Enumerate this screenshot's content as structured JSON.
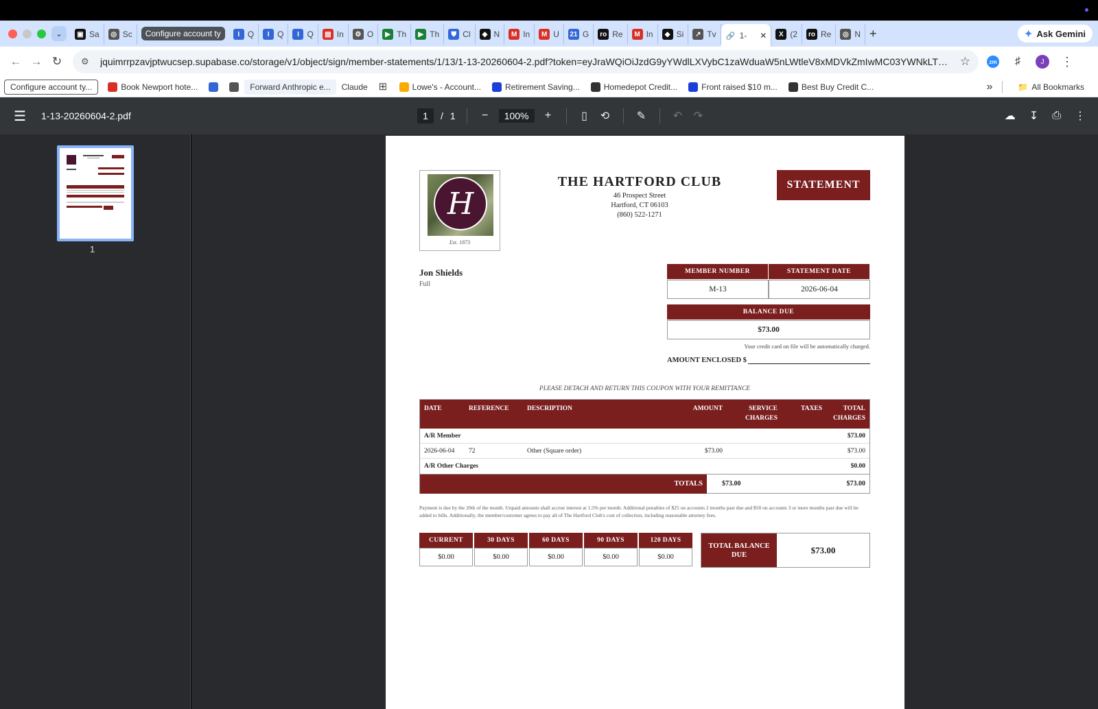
{
  "browser": {
    "tab_group_label": "Configure account ty",
    "tabs": [
      {
        "label": "Sa",
        "icon": "square-icon",
        "color": "#111111"
      },
      {
        "label": "Sc",
        "icon": "globe-icon",
        "color": "#555555"
      },
      {
        "label": "Q",
        "icon": "i-icon",
        "color": "#3367d6"
      },
      {
        "label": "Q",
        "icon": "i-icon",
        "color": "#3367d6"
      },
      {
        "label": "Q",
        "icon": "i-icon",
        "color": "#3367d6"
      },
      {
        "label": "In",
        "icon": "doc-icon",
        "color": "#d93025"
      },
      {
        "label": "O",
        "icon": "gear-icon",
        "color": "#555555"
      },
      {
        "label": "Th",
        "icon": "meet-icon",
        "color": "#188038"
      },
      {
        "label": "Th",
        "icon": "meet-icon",
        "color": "#188038"
      },
      {
        "label": "Cl",
        "icon": "shield-icon",
        "color": "#3367d6"
      },
      {
        "label": "N",
        "icon": "spy-icon",
        "color": "#111111"
      },
      {
        "label": "In",
        "icon": "gmail-icon",
        "color": "#d93025"
      },
      {
        "label": "U",
        "icon": "gmail-icon",
        "color": "#d93025"
      },
      {
        "label": "G",
        "icon": "calendar-icon",
        "color": "#3367d6"
      },
      {
        "label": "Re",
        "icon": "ro-icon",
        "color": "#111111"
      },
      {
        "label": "In",
        "icon": "gmail-icon",
        "color": "#d93025"
      },
      {
        "label": "Si",
        "icon": "spy-icon",
        "color": "#111111"
      },
      {
        "label": "Tv",
        "icon": "link-icon",
        "color": "#555555"
      }
    ],
    "active_tab": {
      "label": "1-"
    },
    "tabs_after": [
      {
        "label": "(2",
        "icon": "x-icon",
        "color": "#111111"
      },
      {
        "label": "Re",
        "icon": "ro-icon",
        "color": "#111111"
      },
      {
        "label": "N",
        "icon": "globe-icon",
        "color": "#555555"
      }
    ],
    "ask_gemini": "Ask Gemini",
    "url": "jquimrrpzavjptwucsep.supabase.co/storage/v1/object/sign/member-statements/1/13/1-13-20260604-2.pdf?token=eyJraWQiOiJzdG9yYWdlLXVybC1zaWduaW5nLWtleV8xMDVkZmIwMC03YWNkLTQ4ZmY...",
    "profile_initial": "J",
    "zoom_ext": "zm"
  },
  "bookmarks": [
    {
      "label": "Configure account ty...",
      "style": "boxed",
      "color": ""
    },
    {
      "label": "Book Newport hote...",
      "style": "plain",
      "color": "#d93025"
    },
    {
      "label": "",
      "style": "plain",
      "color": "#3367d6"
    },
    {
      "label": "",
      "style": "plain",
      "color": "#555555"
    },
    {
      "label": "Forward Anthropic e...",
      "style": "pill",
      "color": ""
    },
    {
      "label": "Claude",
      "style": "plain",
      "color": ""
    },
    {
      "label": "",
      "style": "grid",
      "color": "#444444"
    },
    {
      "label": "Lowe's - Account...",
      "style": "plain",
      "color": "#f9ab00"
    },
    {
      "label": "Retirement Saving...",
      "style": "plain",
      "color": "#1a3ed8"
    },
    {
      "label": "Homedepot Credit...",
      "style": "plain",
      "color": "#333333"
    },
    {
      "label": "Front raised $10 m...",
      "style": "plain",
      "color": "#1a3ed8"
    },
    {
      "label": "Best Buy Credit C...",
      "style": "plain",
      "color": "#333333"
    }
  ],
  "bookmarks_more": "»",
  "all_bookmarks": "All Bookmarks",
  "pdf": {
    "filename": "1-13-20260604-2.pdf",
    "page_current": "1",
    "page_sep": "/",
    "page_total": "1",
    "zoom": "100%",
    "thumb_label": "1"
  },
  "statement": {
    "club_name": "THE HARTFORD CLUB",
    "address1": "46 Prospect Street",
    "address2": "Hartford, CT 06103",
    "phone": "(860) 522-1271",
    "logo_letter": "H",
    "logo_est": "Est. 1873",
    "badge": "STATEMENT",
    "member_name": "Jon Shields",
    "member_type": "Full",
    "member_number_label": "MEMBER NUMBER",
    "statement_date_label": "STATEMENT DATE",
    "member_number": "M-13",
    "statement_date": "2026-06-04",
    "balance_due_label": "BALANCE DUE",
    "balance_due": "$73.00",
    "autopay_note": "Your credit card on file will be automatically charged.",
    "amount_enclosed_label": "AMOUNT ENCLOSED $",
    "detach_note": "PLEASE DETACH AND RETURN THIS COUPON WITH YOUR REMITTANCE",
    "table_headers": {
      "date": "DATE",
      "reference": "REFERENCE",
      "description": "DESCRIPTION",
      "amount": "AMOUNT",
      "service1": "SERVICE",
      "service2": "CHARGES",
      "taxes": "TAXES",
      "total1": "TOTAL",
      "total2": "CHARGES"
    },
    "group1_label": "A/R Member",
    "group1_total": "$73.00",
    "row1": {
      "date": "2026-06-04",
      "reference": "72",
      "description": "Other (Square order)",
      "amount": "$73.00",
      "service": "",
      "taxes": "",
      "total": "$73.00"
    },
    "group2_label": "A/R Other Charges",
    "group2_total": "$0.00",
    "totals_label": "TOTALS",
    "totals_amount": "$73.00",
    "totals_total": "$73.00",
    "terms": "Payment is due by the 20th of the month. Unpaid amounts shall accrue interest at 1.5% per month. Additional penalties of $25 on accounts 2 months past due and $50 on accounts 3 or more months past due will be added to bills. Additionally, the member/customer agrees to pay all of The Hartford Club's cost of collection, including reasonable attorney fees.",
    "aging": {
      "current_label": "CURRENT",
      "current": "$0.00",
      "d30_label": "30 DAYS",
      "d30": "$0.00",
      "d60_label": "60 DAYS",
      "d60": "$0.00",
      "d90_label": "90 DAYS",
      "d90": "$0.00",
      "d120_label": "120 DAYS",
      "d120": "$0.00"
    },
    "total_balance_label": "TOTAL BALANCE DUE",
    "total_balance": "$73.00"
  },
  "colors": {
    "maroon": "#7a1e1e",
    "tab_strip": "#d3e3fd",
    "pdf_toolbar": "#323639"
  }
}
